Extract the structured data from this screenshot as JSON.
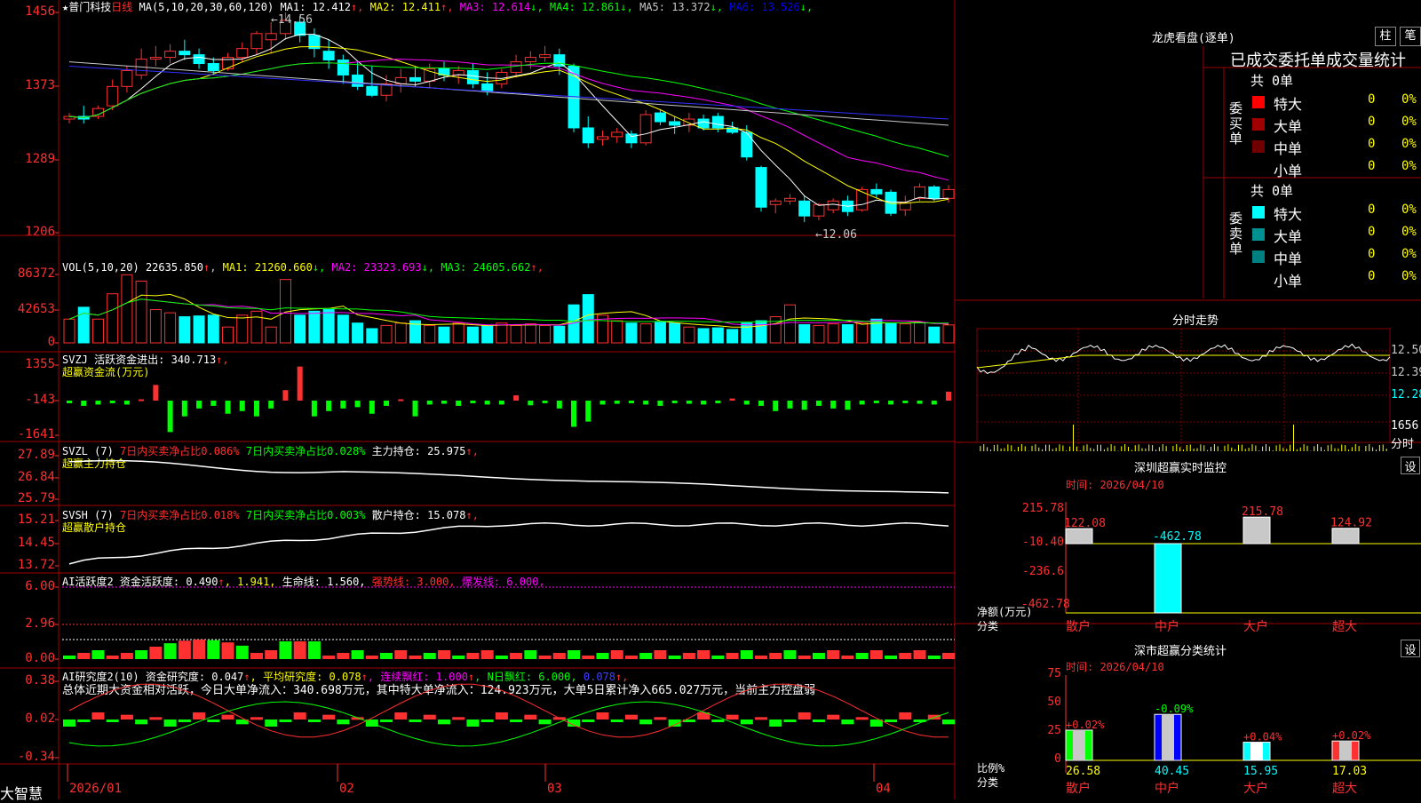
{
  "app": {
    "name": "大智慧"
  },
  "header": {
    "star": "★",
    "stock": "普门科技",
    "period": "日线",
    "ma_params": "MA(5,10,20,30,60,120)",
    "ma": [
      {
        "label": "MA1:",
        "value": "12.412",
        "arrow": "↑",
        "color": "#ffffff"
      },
      {
        "label": "MA2:",
        "value": "12.411",
        "arrow": "↑",
        "color": "#ffff00"
      },
      {
        "label": "MA3:",
        "value": "12.614",
        "arrow": "↓",
        "color": "#ff00ff"
      },
      {
        "label": "MA4:",
        "value": "12.861",
        "arrow": "↓",
        "color": "#00ff00"
      },
      {
        "label": "MA5:",
        "value": "13.372",
        "arrow": "↓",
        "color": "#c8c8c8"
      },
      {
        "label": "MA6:",
        "value": "13.526",
        "arrow": "↓",
        "color": "#0000ff"
      }
    ],
    "high_label": "14.56",
    "low_label": "12.06"
  },
  "panels": {
    "price_ticks": [
      "1456",
      "1373",
      "1289",
      "1206"
    ],
    "vol": {
      "title": "VOL(5,10,20)",
      "value": "22635.850",
      "arrow": "↑",
      "ma": [
        {
          "label": "MA1:",
          "value": "21260.660",
          "arrow": "↓",
          "color": "#ffff00"
        },
        {
          "label": "MA2:",
          "value": "23323.693",
          "arrow": "↓",
          "color": "#ff00ff"
        },
        {
          "label": "MA3:",
          "value": "24605.662",
          "arrow": "↑",
          "color": "#00ff00"
        }
      ],
      "ticks": [
        "86372",
        "42653",
        "0"
      ]
    },
    "svzj": {
      "title": "SVZJ  活跃资金进出:",
      "value": "340.713",
      "arrow": "↑,",
      "sub": "超赢资金流(万元)",
      "ticks": [
        "1355",
        "-143",
        "-1641"
      ]
    },
    "svzl": {
      "title": "SVZL (7)",
      "t1": "7日内买卖净占比0.086%",
      "t2": "7日内买卖净占比0.028%",
      "t3": "主力持仓: 25.975",
      "arrow": "↑,",
      "sub": "超赢主力持仓",
      "ticks": [
        "27.89",
        "26.84",
        "25.79"
      ]
    },
    "svsh": {
      "title": "SVSH (7)",
      "t1": "7日内买卖净占比0.018%",
      "t2": "7日内买卖净占比0.003%",
      "t3": "散户持仓: 15.078",
      "arrow": "↑,",
      "sub": "超赢散户持仓",
      "ticks": [
        "15.21",
        "14.45",
        "13.72"
      ]
    },
    "ai1": {
      "title": "AI活跃度2",
      "t1": "资金活跃度: 0.490",
      "a1": "↑",
      "t2": ", 1.941,",
      "t3": "生命线: 1.560,",
      "t4": "强势线: 3.000,",
      "t5": "爆发线: 6.000,",
      "ticks": [
        "6.00",
        "2.96",
        "0.00"
      ]
    },
    "ai2": {
      "title": "AI研究度2(10)",
      "t1": "资金研究度: 0.047",
      "a1": "↑",
      "t2": ", 平均研究度: 0.078",
      "a2": "↑",
      "t3": ", 连续飘红: 1.000",
      "a3": "↑",
      "t4": ", N日飘红: 6.000,",
      "t5": "0.078",
      "a5": "↑,",
      "summary": "总体近期大资金相对活跃，今日大单净流入：340.698万元，其中特大单净流入：124.923万元，大单5日累计净入665.027万元，当前主力控盘弱",
      "ticks": [
        "0.38",
        "0.02",
        "-0.34"
      ]
    }
  },
  "xaxis": {
    "labels": [
      "2026/01",
      "02",
      "03",
      "04"
    ]
  },
  "right": {
    "dragon": {
      "title": "龙虎看盘(逐单)",
      "btn1": "柱",
      "btn2": "笔",
      "subtitle": "已成交委托单成交量统计",
      "buy_label": "委买单",
      "sell_label": "委卖单",
      "buy_total": "共 0单",
      "sell_total": "共 0单",
      "buy_rows": [
        {
          "name": "特大",
          "n": "0",
          "p": "0%",
          "color": "#ff0000"
        },
        {
          "name": "大单",
          "n": "0",
          "p": "0%",
          "color": "#a00000"
        },
        {
          "name": "中单",
          "n": "0",
          "p": "0%",
          "color": "#700000"
        },
        {
          "name": "小单",
          "n": "0",
          "p": "0%",
          "color": ""
        }
      ],
      "sell_rows": [
        {
          "name": "特大",
          "n": "0",
          "p": "0%",
          "color": "#00ffff"
        },
        {
          "name": "大单",
          "n": "0",
          "p": "0%",
          "color": "#009090"
        },
        {
          "name": "中单",
          "n": "0",
          "p": "0%",
          "color": "#008080"
        },
        {
          "name": "小单",
          "n": "0",
          "p": "0%",
          "color": ""
        }
      ]
    },
    "intraday": {
      "title": "分时走势",
      "ticks": [
        "12.50",
        "12.39",
        "12.28",
        "1656",
        "分时"
      ]
    },
    "sz_monitor": {
      "title": "深圳超赢实时监控",
      "btn": "设",
      "time": "时间: 2026/04/10",
      "ylabel1": "净额(万元)",
      "ylabel2": "分类",
      "ticks": [
        "215.78",
        "-10.40",
        "-236.6",
        "-462.78"
      ]
    },
    "sz_class": {
      "title": "深市超赢分类统计",
      "btn": "设",
      "time": "时间: 2026/04/10",
      "ylabel1": "比例%",
      "ylabel2": "分类",
      "ticks": [
        "75",
        "50",
        "25",
        "0"
      ]
    }
  },
  "chart_data": [
    {
      "type": "candlestick",
      "title": "普门科技 日线",
      "ylim": [
        12.06,
        14.56
      ],
      "y_ticks": [
        14.56,
        13.73,
        12.89,
        12.06
      ],
      "ohlc": [
        [
          13.35,
          13.42,
          13.3,
          13.38
        ],
        [
          13.38,
          13.5,
          13.3,
          13.35
        ],
        [
          13.38,
          13.5,
          13.35,
          13.47
        ],
        [
          13.5,
          13.8,
          13.45,
          13.72
        ],
        [
          13.72,
          13.95,
          13.65,
          13.9
        ],
        [
          13.85,
          14.15,
          13.8,
          14.03
        ],
        [
          14.03,
          14.18,
          13.95,
          14.05
        ],
        [
          14.05,
          14.2,
          13.98,
          14.12
        ],
        [
          14.12,
          14.25,
          14.02,
          14.08
        ],
        [
          14.08,
          14.15,
          13.92,
          13.98
        ],
        [
          13.98,
          14.05,
          13.85,
          13.9
        ],
        [
          13.92,
          14.1,
          13.9,
          14.05
        ],
        [
          14.05,
          14.22,
          14.0,
          14.15
        ],
        [
          14.15,
          14.35,
          14.08,
          14.32
        ],
        [
          14.25,
          14.45,
          14.1,
          14.32
        ],
        [
          14.32,
          14.56,
          14.25,
          14.47
        ],
        [
          14.45,
          14.52,
          14.22,
          14.3
        ],
        [
          14.3,
          14.38,
          14.05,
          14.15
        ],
        [
          14.12,
          14.25,
          13.92,
          14.02
        ],
        [
          14.02,
          14.08,
          13.75,
          13.85
        ],
        [
          13.85,
          14.0,
          13.68,
          13.72
        ],
        [
          13.72,
          13.95,
          13.6,
          13.62
        ],
        [
          13.62,
          13.85,
          13.55,
          13.75
        ],
        [
          13.75,
          13.92,
          13.65,
          13.82
        ],
        [
          13.82,
          13.95,
          13.72,
          13.78
        ],
        [
          13.78,
          13.98,
          13.7,
          13.92
        ],
        [
          13.92,
          14.0,
          13.78,
          13.85
        ],
        [
          13.85,
          13.95,
          13.75,
          13.9
        ],
        [
          13.9,
          13.98,
          13.7,
          13.75
        ],
        [
          13.75,
          13.88,
          13.62,
          13.67
        ],
        [
          13.75,
          13.92,
          13.7,
          13.88
        ],
        [
          13.88,
          14.08,
          13.82,
          14.0
        ],
        [
          14.0,
          14.12,
          13.92,
          14.05
        ],
        [
          14.05,
          14.18,
          14.0,
          14.08
        ],
        [
          14.08,
          14.15,
          13.85,
          13.95
        ],
        [
          13.95,
          13.98,
          13.2,
          13.25
        ],
        [
          13.25,
          13.38,
          13.02,
          13.08
        ],
        [
          13.12,
          13.22,
          13.05,
          13.15
        ],
        [
          13.15,
          13.25,
          13.08,
          13.2
        ],
        [
          13.18,
          13.22,
          13.02,
          13.08
        ],
        [
          13.08,
          13.45,
          13.05,
          13.4
        ],
        [
          13.42,
          13.45,
          13.28,
          13.32
        ],
        [
          13.32,
          13.38,
          13.18,
          13.28
        ],
        [
          13.28,
          13.42,
          13.2,
          13.35
        ],
        [
          13.35,
          13.4,
          13.22,
          13.25
        ],
        [
          13.38,
          13.42,
          13.2,
          13.25
        ],
        [
          13.25,
          13.32,
          13.18,
          13.2
        ],
        [
          13.2,
          13.28,
          12.88,
          12.92
        ],
        [
          12.8,
          12.82,
          12.3,
          12.35
        ],
        [
          12.38,
          12.45,
          12.28,
          12.42
        ],
        [
          12.42,
          12.5,
          12.38,
          12.45
        ],
        [
          12.42,
          12.48,
          12.18,
          12.25
        ],
        [
          12.25,
          12.4,
          12.2,
          12.38
        ],
        [
          12.32,
          12.45,
          12.28,
          12.42
        ],
        [
          12.42,
          12.48,
          12.25,
          12.3
        ],
        [
          12.32,
          12.58,
          12.3,
          12.55
        ],
        [
          12.55,
          12.62,
          12.45,
          12.5
        ],
        [
          12.52,
          12.55,
          12.25,
          12.28
        ],
        [
          12.32,
          12.48,
          12.25,
          12.4
        ],
        [
          12.45,
          12.62,
          12.42,
          12.58
        ],
        [
          12.58,
          12.6,
          12.42,
          12.45
        ],
        [
          12.45,
          12.6,
          12.4,
          12.55
        ]
      ],
      "series": [
        {
          "name": "MA1"
        },
        {
          "name": "MA2"
        },
        {
          "name": "MA3"
        },
        {
          "name": "MA4"
        },
        {
          "name": "MA5"
        },
        {
          "name": "MA6"
        }
      ]
    },
    {
      "type": "bar",
      "title": "VOL(5,10,20)",
      "ylim": [
        0,
        86372
      ],
      "values": [
        30000,
        45000,
        30000,
        62000,
        86000,
        78000,
        42000,
        38000,
        33000,
        34000,
        35000,
        20000,
        35000,
        40000,
        20000,
        80000,
        35000,
        40000,
        42000,
        35000,
        25000,
        18000,
        22000,
        25000,
        28000,
        22000,
        20000,
        25000,
        20000,
        22000,
        25000,
        22000,
        24000,
        22000,
        21000,
        48000,
        61000,
        35000,
        28000,
        25000,
        24000,
        26000,
        25000,
        20000,
        18000,
        19000,
        17000,
        25000,
        28000,
        33000,
        48000,
        23000,
        22000,
        24000,
        23000,
        25000,
        30000,
        25000,
        24000,
        26000,
        20000,
        22635
      ]
    },
    {
      "type": "bar",
      "title": "SVZJ 活跃资金进出",
      "ylim": [
        -1641,
        1355
      ],
      "values": [
        -100,
        -200,
        -150,
        -100,
        -150,
        50,
        600,
        -1200,
        -600,
        -300,
        -200,
        -500,
        -400,
        -600,
        -300,
        400,
        1300,
        -600,
        -400,
        -300,
        -250,
        -500,
        -200,
        50,
        -600,
        -150,
        -120,
        -200,
        -100,
        -150,
        -150,
        200,
        -180,
        -100,
        -300,
        -1000,
        -800,
        -150,
        -120,
        -100,
        -150,
        -200,
        -100,
        -120,
        -150,
        -100,
        80,
        -150,
        -200,
        -400,
        -300,
        -350,
        -200,
        -300,
        -350,
        -150,
        -100,
        -150,
        -100,
        -120,
        -150,
        340
      ]
    },
    {
      "type": "line",
      "title": "SVZL 主力持仓",
      "ylim": [
        25.79,
        27.89
      ]
    },
    {
      "type": "line",
      "title": "SVSH 散户持仓",
      "ylim": [
        13.72,
        15.21
      ]
    },
    {
      "type": "bar",
      "title": "AI活跃度2",
      "ylim": [
        0,
        6.0
      ]
    },
    {
      "type": "bar",
      "title": "AI研究度2(10)",
      "ylim": [
        -0.34,
        0.38
      ]
    },
    {
      "type": "bar",
      "title": "深圳超赢实时监控",
      "categories": [
        "散户",
        "中户",
        "大户",
        "超大"
      ],
      "values": [
        122.08,
        -462.78,
        215.78,
        124.92
      ],
      "ylim": [
        -462.78,
        215.78
      ]
    },
    {
      "type": "bar",
      "title": "深市超赢分类统计",
      "categories": [
        "散户",
        "中户",
        "大户",
        "超大"
      ],
      "values": [
        26.58,
        40.45,
        15.95,
        17.03
      ],
      "labels": [
        "+0.02%",
        "-0.09%",
        "+0.04%",
        "+0.02%"
      ],
      "ylim": [
        0,
        75
      ]
    }
  ]
}
